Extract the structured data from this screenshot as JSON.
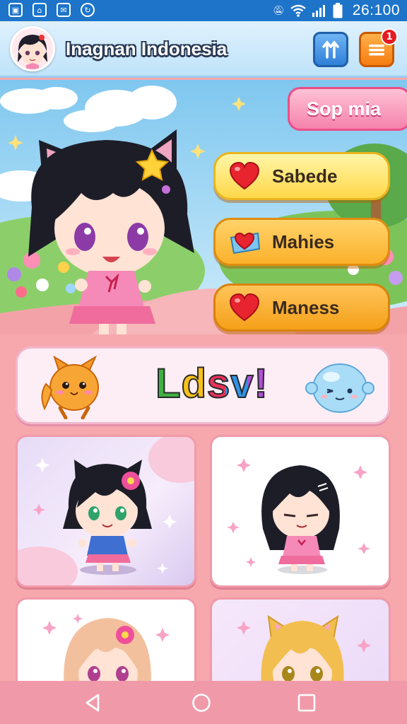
{
  "status_bar": {
    "time": "26:100",
    "icons": [
      "image-icon",
      "home-icon",
      "mail-icon",
      "sync-icon",
      "mute-icon",
      "wifi-icon",
      "signal-icon",
      "battery-icon"
    ]
  },
  "header": {
    "title": "Inagnan Indonesia",
    "menu_badge": "1"
  },
  "hero": {
    "shop_button": "Sop mia",
    "actions": [
      {
        "label": "Sabede",
        "icon": "heart-icon"
      },
      {
        "label": "Mahies",
        "icon": "heart-box-icon"
      },
      {
        "label": "Maness",
        "icon": "heart-icon"
      }
    ]
  },
  "banner": {
    "text": "Ldsv!"
  },
  "colors": {
    "status_bar": "#1d74c9",
    "accent_pink": "#f582ab",
    "accent_orange": "#f57d10",
    "accent_blue": "#2f80d8",
    "background": "#f6a8ad"
  },
  "navigation": {
    "buttons": [
      "back-icon",
      "home-icon",
      "recents-icon"
    ]
  }
}
